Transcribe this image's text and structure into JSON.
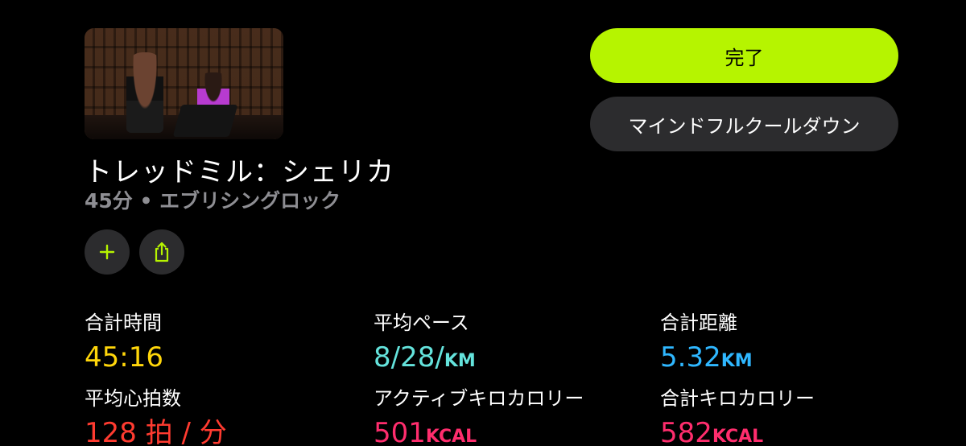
{
  "workout": {
    "title": "トレッドミル：シェリカ",
    "subtitle": "45分 • エブリシングロック"
  },
  "actions": {
    "done_label": "完了",
    "cooldown_label": "マインドフルクールダウン"
  },
  "icons": {
    "add": "plus-icon",
    "share": "share-icon",
    "accent": "#b6f400"
  },
  "stats": [
    {
      "label": "合計時間",
      "value": "45:16",
      "unit": "",
      "color": "#ffd60a"
    },
    {
      "label": "平均ペース",
      "value": "8/28/",
      "unit": "KM",
      "color": "#64e3dc"
    },
    {
      "label": "合計距離",
      "value": "5.32",
      "unit": "KM",
      "color": "#2fb7ff"
    },
    {
      "label": "平均心拍数",
      "value": "128 拍 / 分",
      "unit": "",
      "color": "#ff3b30"
    },
    {
      "label": "アクティブキロカロリー",
      "value": "501",
      "unit": "KCAL",
      "color": "#ff2d6d"
    },
    {
      "label": "合計キロカロリー",
      "value": "582",
      "unit": "KCAL",
      "color": "#ff2d6d"
    }
  ]
}
